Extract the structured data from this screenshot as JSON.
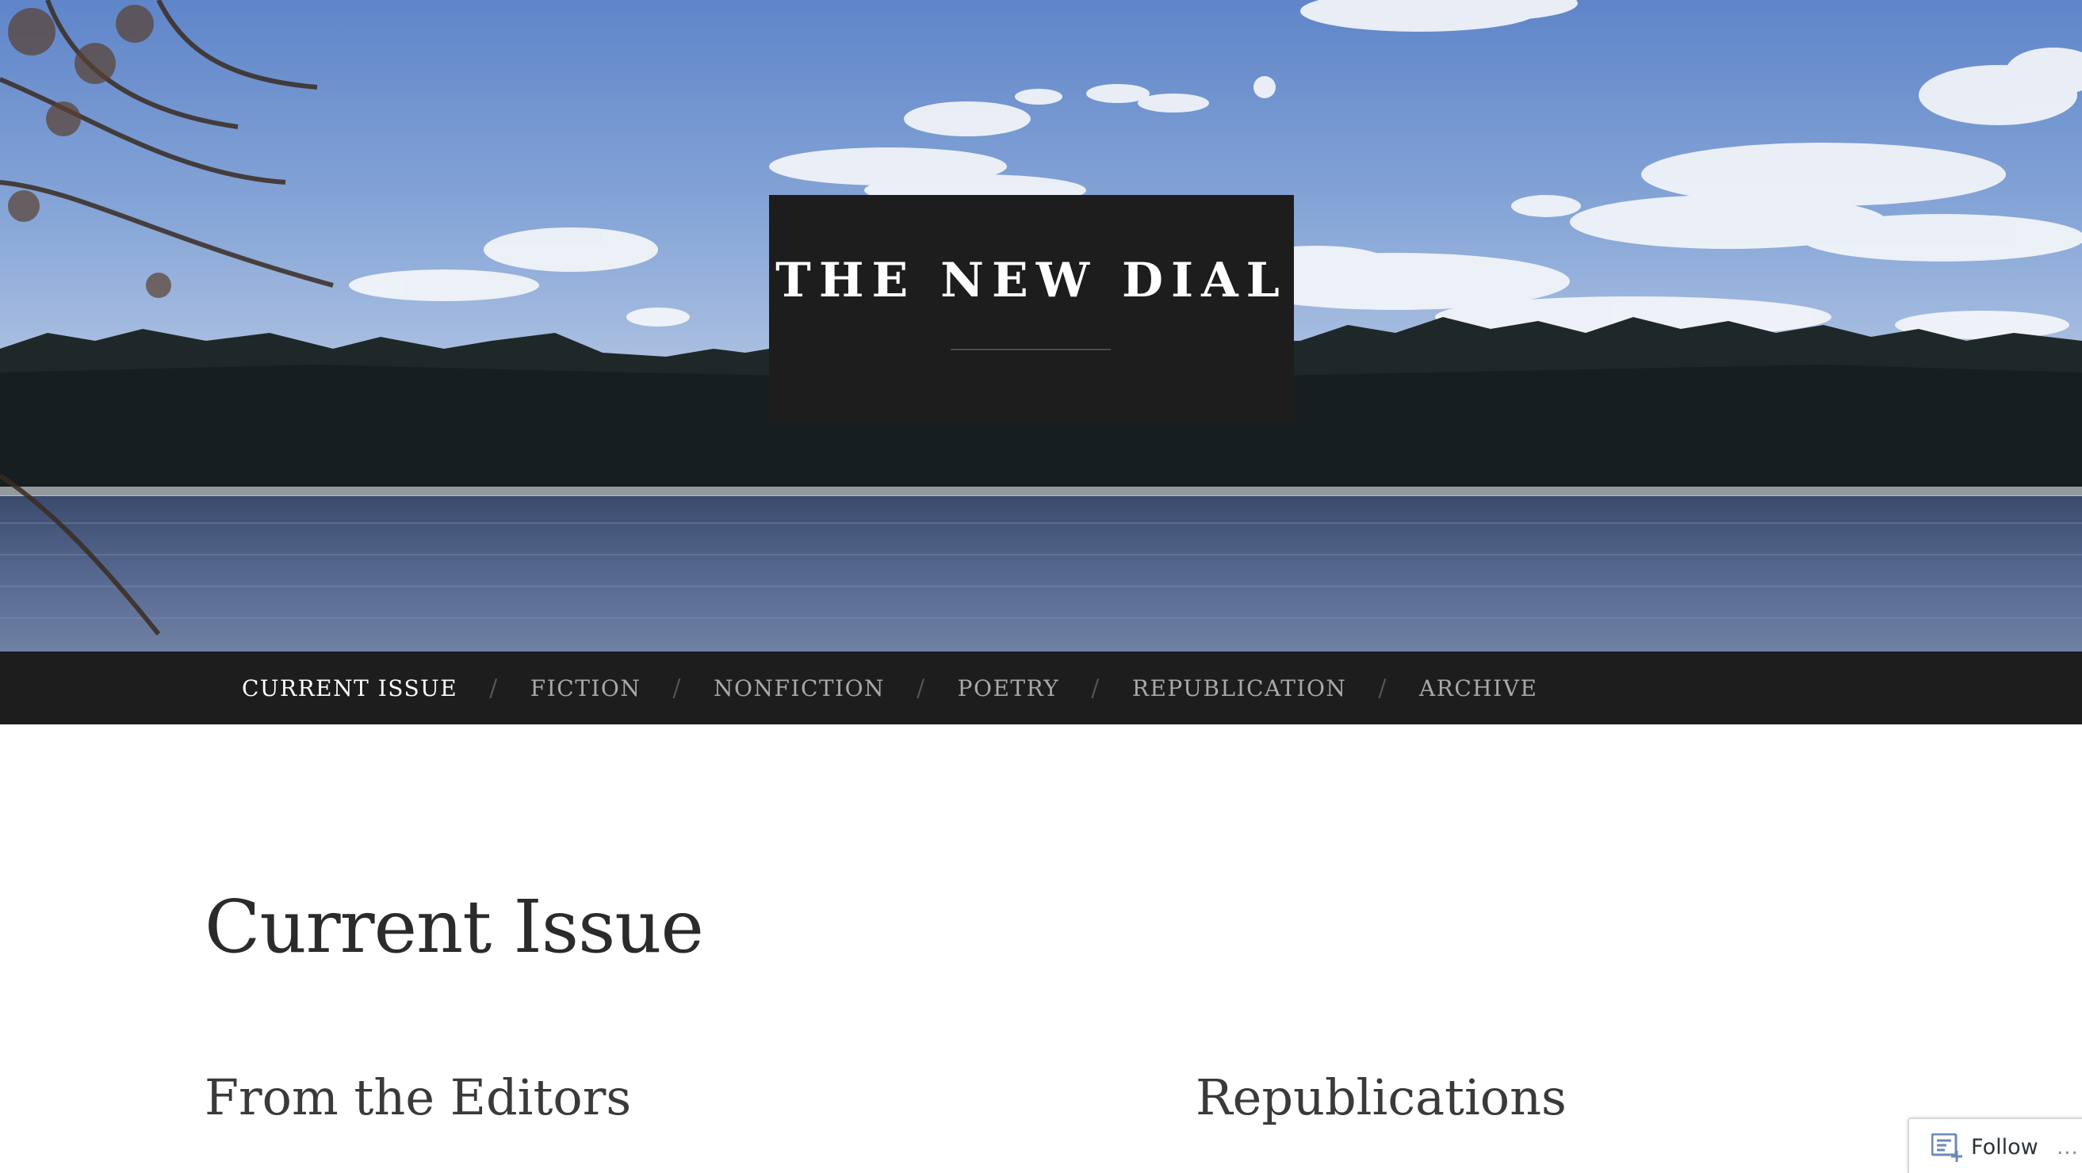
{
  "site": {
    "title": "THE NEW DIAL"
  },
  "nav": {
    "items": [
      {
        "label": "CURRENT ISSUE",
        "active": true
      },
      {
        "label": "FICTION",
        "active": false
      },
      {
        "label": "NONFICTION",
        "active": false
      },
      {
        "label": "POETRY",
        "active": false
      },
      {
        "label": "REPUBLICATION",
        "active": false
      },
      {
        "label": "ARCHIVE",
        "active": false
      }
    ],
    "separator": "/"
  },
  "main": {
    "page_title": "Current Issue",
    "sections": [
      {
        "heading": "From the Editors"
      },
      {
        "heading": "Republications"
      }
    ]
  },
  "follow_widget": {
    "label": "Follow",
    "more": "...",
    "icon": "reader-follow-icon"
  },
  "colors": {
    "header_bg": "#1d1d1d",
    "nav_active": "#ffffff",
    "nav_inactive": "#a9a9a9",
    "heading_text": "#2b2b2b",
    "follow_icon": "#6b8bb4"
  }
}
